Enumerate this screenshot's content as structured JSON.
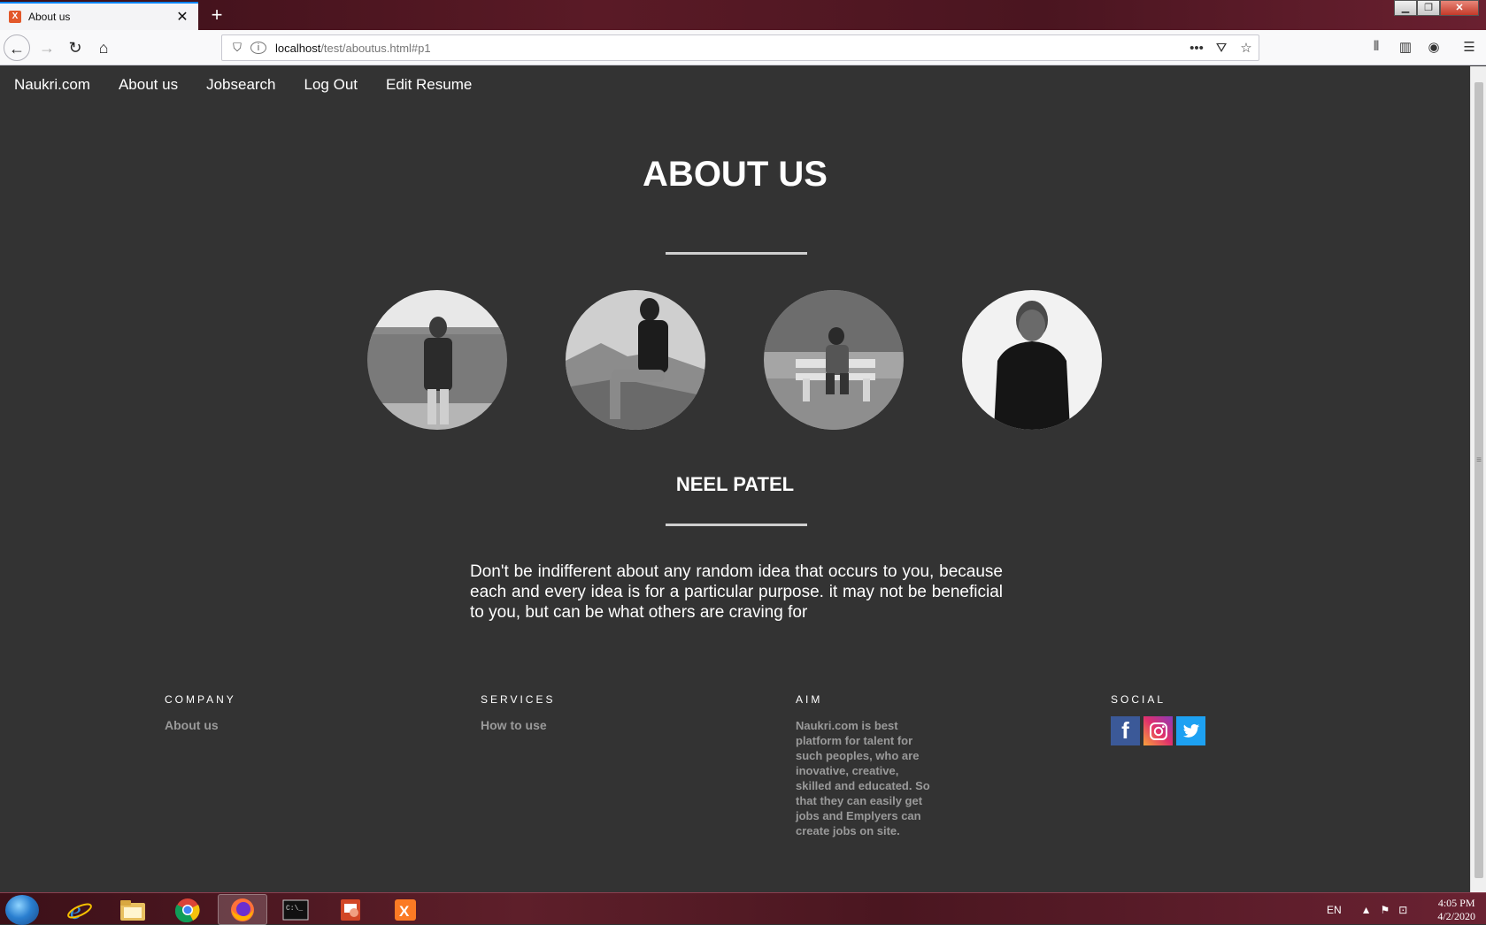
{
  "browser": {
    "tab_title": "About us",
    "new_tab_label": "+",
    "url_host": "localhost",
    "url_path": "/test/aboutus.html#p1",
    "icons": [
      "shield-icon",
      "info-icon",
      "more-actions-icon",
      "pocket-icon",
      "bookmark-star-icon",
      "library-icon",
      "sidebar-icon",
      "account-icon",
      "menu-icon"
    ]
  },
  "site_nav": {
    "items": [
      {
        "label": "Naukri.com"
      },
      {
        "label": "About us"
      },
      {
        "label": "Jobsearch"
      },
      {
        "label": "Log Out"
      },
      {
        "label": "Edit Resume"
      }
    ]
  },
  "about": {
    "title": "ABOUT US",
    "member_name": "NEEL PATEL",
    "quote": "Don't be indifferent about any random idea that occurs to you, because each and every idea is for a particular purpose. it may not be beneficial to you, but can be what others are craving for"
  },
  "footer": {
    "company": {
      "heading": "COMPANY",
      "link": "About us"
    },
    "services": {
      "heading": "SERVICES",
      "link": "How to use"
    },
    "aim": {
      "heading": "AIM",
      "text": "Naukri.com is best platform for talent for such peoples, who are inovative, creative, skilled and educated. So that they can easily get jobs and Emplyers can create jobs on site."
    },
    "social": {
      "heading": "SOCIAL",
      "icons": [
        "facebook-icon",
        "instagram-icon",
        "twitter-icon"
      ]
    }
  },
  "taskbar": {
    "lang": "EN",
    "time": "4:05 PM",
    "date": "4/2/2020",
    "apps": [
      "internet-explorer",
      "file-explorer",
      "chrome",
      "firefox",
      "command-prompt",
      "powerpoint",
      "xampp"
    ]
  },
  "colors": {
    "page_bg": "#333333",
    "facebook": "#3b5998",
    "twitter": "#1da1f2",
    "instagram": "#c13584"
  }
}
